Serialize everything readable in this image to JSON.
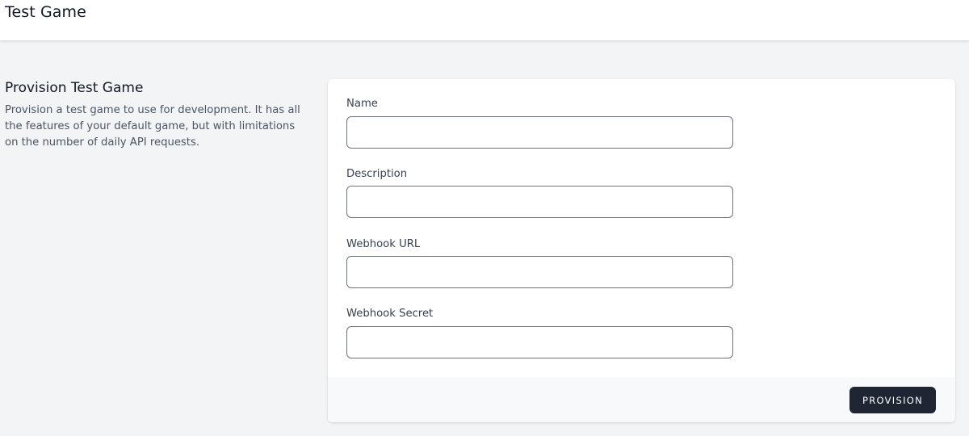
{
  "header": {
    "title": "Test Game"
  },
  "section": {
    "heading": "Provision Test Game",
    "description": "Provision a test game to use for development. It has all the features of your default game, but with limitations on the number of daily API requests."
  },
  "form": {
    "fields": [
      {
        "label": "Name",
        "value": "",
        "placeholder": ""
      },
      {
        "label": "Description",
        "value": "",
        "placeholder": ""
      },
      {
        "label": "Webhook URL",
        "value": "",
        "placeholder": ""
      },
      {
        "label": "Webhook Secret",
        "value": "",
        "placeholder": ""
      }
    ],
    "submit_label": "PROVISION"
  },
  "colors": {
    "page_background": "#f3f4f6",
    "card_background": "#ffffff",
    "footer_background": "#f8f9fb",
    "button_background": "#1f2533",
    "button_text": "#ffffff"
  }
}
